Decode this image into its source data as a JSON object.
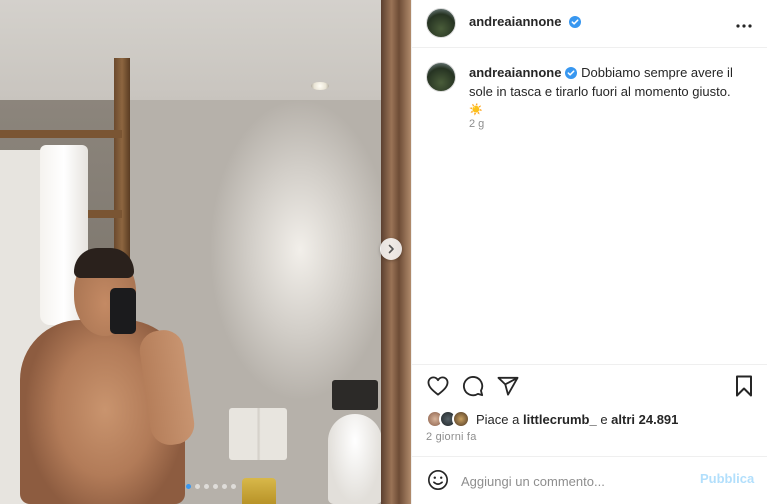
{
  "post": {
    "media": {
      "alt": "",
      "slide_count": 6,
      "active_slide": 0,
      "next_icon": "chevron-right-icon"
    },
    "header": {
      "username": "andreaiannone",
      "verified": true,
      "more_icon": "more-horizontal-icon"
    },
    "caption": {
      "username": "andreaiannone",
      "text": "Dobbiamo sempre avere il sole in tasca e tirarlo fuori al momento giusto.",
      "emoji": "☀️",
      "time_ago": "2 g"
    },
    "actions": {
      "like_icon": "heart-icon",
      "comment_icon": "comment-icon",
      "share_icon": "send-icon",
      "save_icon": "bookmark-icon"
    },
    "likes": {
      "prefix": "Piace a",
      "liker": "littlecrumb_",
      "conjunction": "e",
      "others": "altri 24.891"
    },
    "date_label": "2 giorni fa",
    "comment_box": {
      "placeholder": "Aggiungi un commento...",
      "publish_label": "Pubblica",
      "emoji_icon": "smiley-icon"
    },
    "colors": {
      "verified": "#3897f0",
      "publish_disabled": "#b2dffc",
      "muted_text": "#8e8e8e"
    }
  }
}
